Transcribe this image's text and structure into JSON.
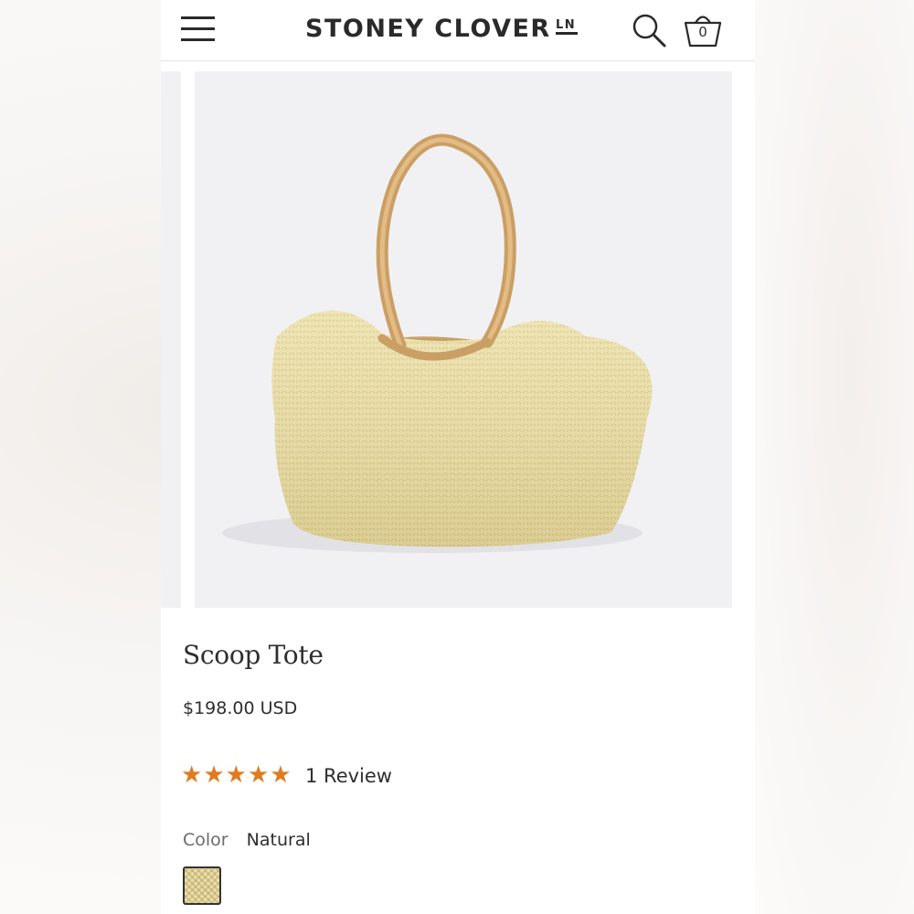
{
  "header": {
    "brand": "STONEY CLOVER",
    "brand_mark": "LN",
    "cart_count": "0",
    "icons": {
      "menu": "hamburger-menu-icon",
      "search": "search-icon",
      "cart": "shopping-bag-icon"
    }
  },
  "product": {
    "title": "Scoop Tote",
    "price": "$198.00 USD",
    "rating": {
      "stars": 5,
      "max": 5,
      "review_text": "1 Review"
    },
    "color": {
      "label": "Color",
      "value": "Natural"
    }
  },
  "colors": {
    "star": "#e07b1f",
    "image_bg": "#f1f1f3",
    "swatch": "#ecdfa9"
  }
}
